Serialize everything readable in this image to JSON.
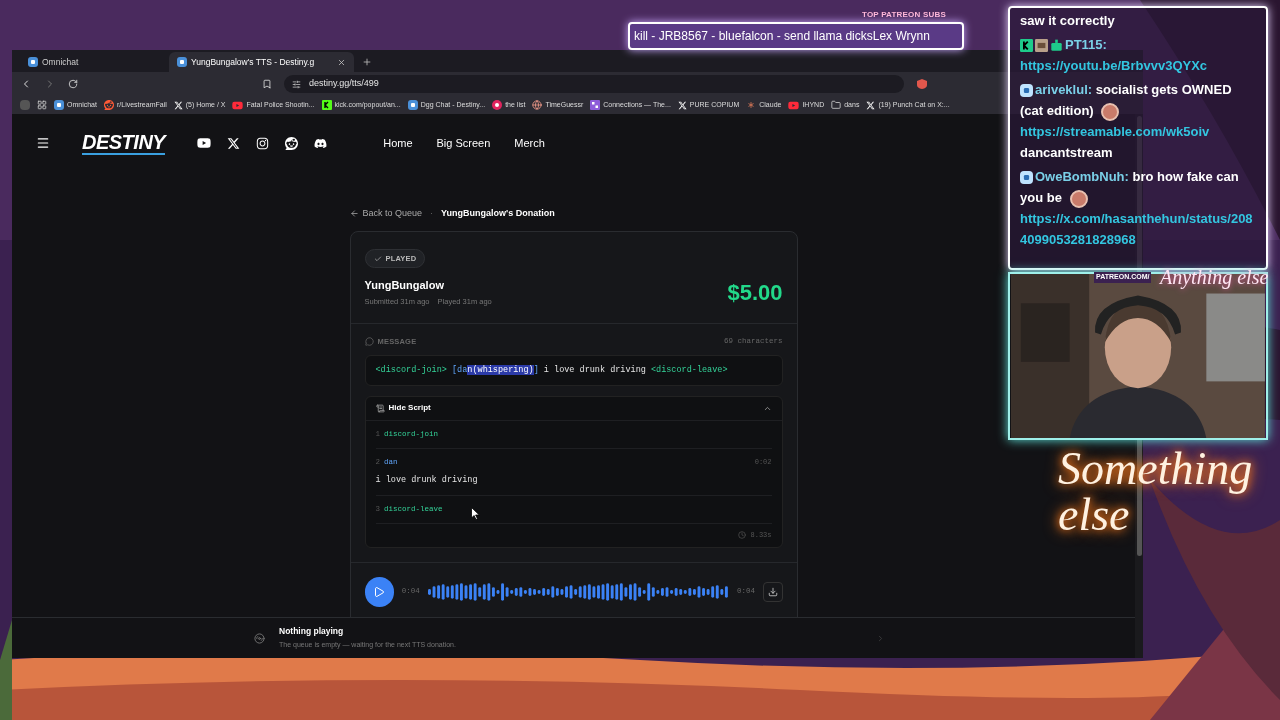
{
  "ticker": {
    "heading": "TOP PATREON SUBS",
    "text": "kill - JRB8567 - bluefalcon - send llama dicksLex Wrynn"
  },
  "browser": {
    "tabs": [
      {
        "label": "Omnichat",
        "selected": false
      },
      {
        "label": "YungBungalow's TTS - Destiny.g",
        "selected": true
      }
    ],
    "url": "destiny.gg/tts/499",
    "bookmarks": [
      {
        "label": "Omnichat",
        "kind": "dgg"
      },
      {
        "label": "r/LivestreamFail",
        "kind": "reddit"
      },
      {
        "label": "(5) Home / X",
        "kind": "x"
      },
      {
        "label": "Fatal Police Shootin...",
        "kind": "youtube"
      },
      {
        "label": "kick.com/popout/an...",
        "kind": "kick"
      },
      {
        "label": "Dgg Chat - Destiny...",
        "kind": "dgg"
      },
      {
        "label": "the list",
        "kind": "target"
      },
      {
        "label": "TimeGuessr",
        "kind": "globe"
      },
      {
        "label": "Connections — The...",
        "kind": "grid"
      },
      {
        "label": "PURE  COPIUM",
        "kind": "x"
      },
      {
        "label": "Claude",
        "kind": "claude"
      },
      {
        "label": "IHYND",
        "kind": "youtube"
      },
      {
        "label": "dans",
        "kind": "folder"
      },
      {
        "label": "(19) Punch Cat on X:...",
        "kind": "x"
      }
    ]
  },
  "site": {
    "logo": "DESTINY",
    "nav": [
      "Home",
      "Big Screen",
      "Merch"
    ],
    "breadcrumb": {
      "back": "Back to Queue",
      "separator": "·",
      "current": "YungBungalow's Donation"
    },
    "donation": {
      "status": "PLAYED",
      "played": true,
      "donor": "YungBungalow",
      "submitted": "Submitted 31m ago",
      "played_at": "Played 31m ago",
      "amount": "$5.00",
      "message_label": "MESSAGE",
      "char_count": "69 characters",
      "message": [
        {
          "kind": "tag",
          "text": "<discord-join>"
        },
        {
          "kind": "voice",
          "text": " [da"
        },
        {
          "kind": "selected",
          "text": "n(whispering)"
        },
        {
          "kind": "voice",
          "text": "]"
        },
        {
          "kind": "plain",
          "text": " i love drunk driving "
        },
        {
          "kind": "tag",
          "text": "<discord-leave>"
        }
      ],
      "script": {
        "toggle": "Hide Script",
        "expanded": true,
        "lines": [
          {
            "number": "1",
            "kind": "tag",
            "label": "discord-join"
          },
          {
            "number": "2",
            "kind": "voice",
            "label": "dan",
            "time": "0:02",
            "text": "i love drunk driving"
          },
          {
            "number": "3",
            "kind": "tag",
            "label": "discord-leave"
          }
        ],
        "duration": "8.33s"
      },
      "audio": {
        "current": "0:04",
        "total": "0:04"
      }
    },
    "player": {
      "title": "Nothing playing",
      "subtitle": "The queue is empty — waiting for the next TTS donation."
    }
  },
  "chat": [
    {
      "parts": [
        {
          "kind": "text",
          "text": "saw it correctly"
        }
      ]
    },
    {
      "user": "PT115:",
      "badges": [
        {
          "kind": "kick"
        },
        {
          "kind": "sub"
        },
        {
          "kind": "bot"
        }
      ],
      "parts": [
        {
          "kind": "link",
          "text": "https://youtu.be/Brbvvv3QYXc"
        }
      ]
    },
    {
      "user": "ariveklul:",
      "badges": [
        {
          "kind": "dgg"
        }
      ],
      "parts": [
        {
          "kind": "text",
          "text": "socialist gets OWNED (cat edition)"
        },
        {
          "kind": "emote"
        },
        {
          "kind": "link",
          "text": "https://streamable.com/wk5oiv"
        },
        {
          "kind": "text",
          "text": "dancantstream"
        }
      ]
    },
    {
      "user": "OweBombNuh:",
      "badges": [
        {
          "kind": "dgg"
        }
      ],
      "parts": [
        {
          "kind": "text",
          "text": "bro how fake can you be"
        },
        {
          "kind": "emote"
        },
        {
          "kind": "link",
          "text": "https://x.com/hasanthehun/status/2084099053281828968"
        }
      ]
    }
  ],
  "overlay": {
    "patreon": "PATREON.COM/",
    "signature": "Anything else",
    "neon": "Something else"
  }
}
